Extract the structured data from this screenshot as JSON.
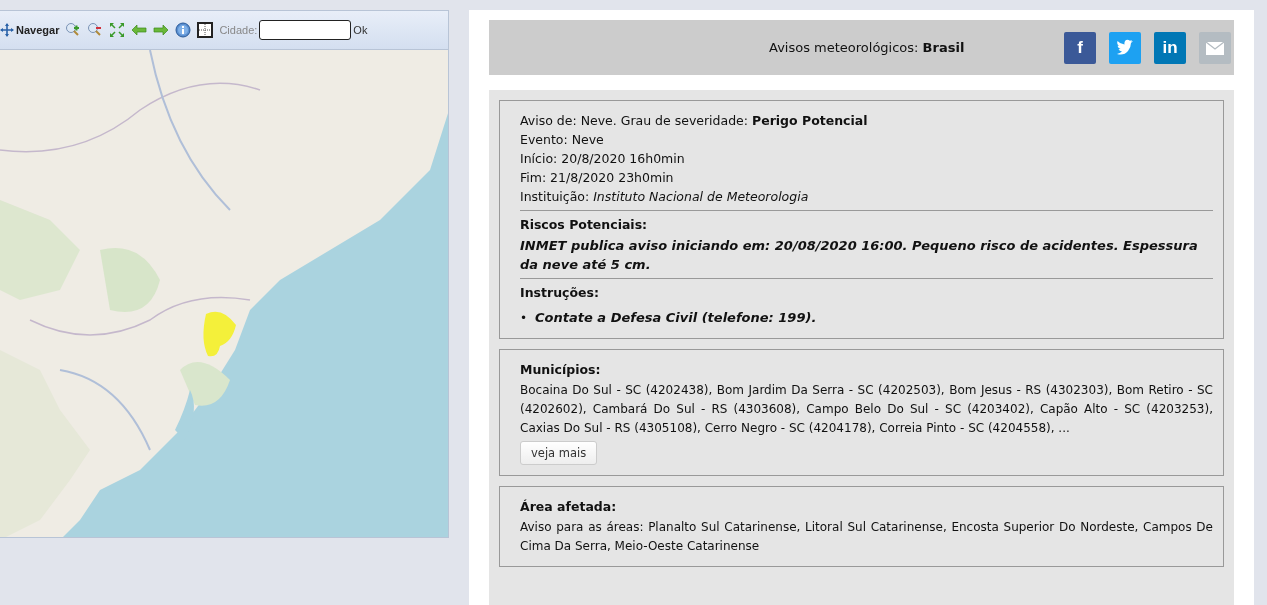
{
  "map_toolbar": {
    "tools": [
      {
        "kind": "pan",
        "label": "Navegar"
      },
      {
        "kind": "zoom-in"
      },
      {
        "kind": "zoom-out"
      },
      {
        "kind": "extent"
      },
      {
        "kind": "back"
      },
      {
        "kind": "forward"
      },
      {
        "kind": "info"
      },
      {
        "kind": "grid"
      }
    ],
    "city_label": "Cidade:",
    "ok": "Ok"
  },
  "header": {
    "title": "Avisos meteorológicos: **Brasil**",
    "share": [
      {
        "kind": "facebook",
        "label": "f",
        "color": "#3b5998"
      },
      {
        "kind": "twitter",
        "color": "#1da1f2"
      },
      {
        "kind": "linkedin",
        "label": "in",
        "color": "#0077b5"
      },
      {
        "kind": "email",
        "color": "#b4bcc2"
      }
    ]
  },
  "alert": {
    "lines": [
      "Aviso de: Neve. Grau de severidade: **Perigo Potencial**",
      "Evento: Neve",
      "Início: 20/8/2020 16h0min",
      "Fim: 21/8/2020 23h0min",
      "Instituição: *Instituto Nacional de Meteorologia*"
    ],
    "risks_title": "Riscos Potenciais:",
    "risks": "INMET publica aviso iniciando em: 20/08/2020 16:00. Pequeno risco de acidentes. Espessura da neve até 5 cm.",
    "instructions_title": "Instruções:",
    "instructions": [
      {
        "bullet": "•",
        "text": "Contate a Defesa Civil (telefone: 199)."
      }
    ]
  },
  "municipalities": {
    "title": "Municípios:",
    "text": "Bocaina Do Sul - SC (4202438), Bom Jardim Da Serra - SC (4202503), Bom Jesus - RS (4302303), Bom Retiro - SC (4202602), Cambará Do Sul - RS (4303608), Campo Belo Do Sul - SC (4203402), Capão Alto - SC (4203253), Caxias Do Sul - RS (4305108), Cerro Negro - SC (4204178), Correia Pinto - SC (4204558), ...",
    "more_button": "veja mais"
  },
  "area": {
    "title": "Área afetada:",
    "text": "Aviso para as áreas: Planalto Sul Catarinense, Litoral Sul Catarinense, Encosta Superior Do Nordeste, Campos De Cima Da Serra, Meio-Oeste Catarinense"
  }
}
